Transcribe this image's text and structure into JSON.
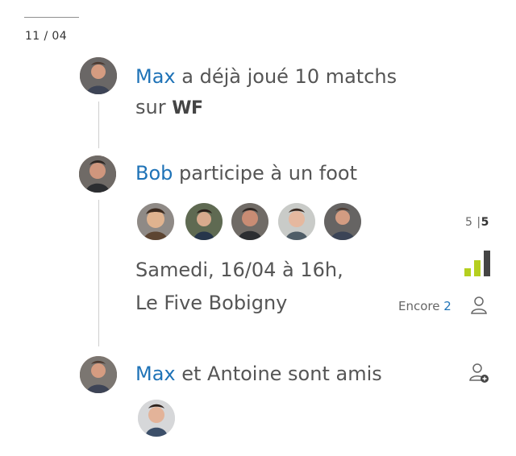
{
  "date_label": "11 / 04",
  "feed": {
    "item1": {
      "name": "Max",
      "text_a": " a déjà joué 10 matchs",
      "text_b": "sur ",
      "logo": "WF"
    },
    "item2": {
      "name": "Bob",
      "text": " participe à un foot",
      "event_date": "Samedi, 16/04 à 16h,",
      "event_place": "Le Five Bobigny",
      "players_count": "5",
      "players_total": "5",
      "separator": "|",
      "remaining_label": "Encore ",
      "remaining_count": "2",
      "bar_colors": [
        "#b5cf1f",
        "#b5cf1f",
        "#444444"
      ]
    },
    "item3": {
      "name": "Max",
      "text": " et Antoine sont amis"
    }
  },
  "icons": {
    "person": "person-icon",
    "add_friend": "add-friend-icon"
  }
}
